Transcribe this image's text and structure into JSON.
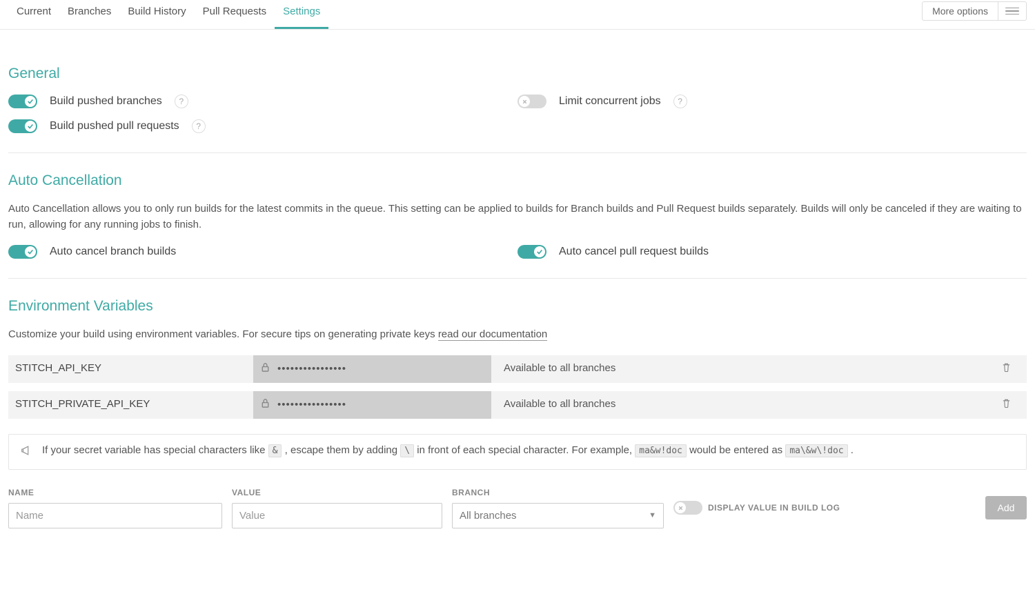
{
  "tabs": [
    "Current",
    "Branches",
    "Build History",
    "Pull Requests",
    "Settings"
  ],
  "active_tab": "Settings",
  "more_options_label": "More options",
  "sections": {
    "general": {
      "title": "General",
      "items": {
        "build_pushed_branches": {
          "label": "Build pushed branches",
          "on": true,
          "help": true
        },
        "build_pushed_prs": {
          "label": "Build pushed pull requests",
          "on": true,
          "help": true
        },
        "limit_concurrent": {
          "label": "Limit concurrent jobs",
          "on": false,
          "help": true
        }
      }
    },
    "auto_cancel": {
      "title": "Auto Cancellation",
      "desc": "Auto Cancellation allows you to only run builds for the latest commits in the queue. This setting can be applied to builds for Branch builds and Pull Request builds separately. Builds will only be canceled if they are waiting to run, allowing for any running jobs to finish.",
      "items": {
        "cancel_branch": {
          "label": "Auto cancel branch builds",
          "on": true
        },
        "cancel_pr": {
          "label": "Auto cancel pull request builds",
          "on": true
        }
      }
    },
    "env_vars": {
      "title": "Environment Variables",
      "desc_prefix": "Customize your build using environment variables. For secure tips on generating private keys ",
      "doc_link_text": "read our documentation",
      "rows": [
        {
          "name": "STITCH_API_KEY",
          "masked": "••••••••••••••••",
          "scope": "Available to all branches"
        },
        {
          "name": "STITCH_PRIVATE_API_KEY",
          "masked": "••••••••••••••••",
          "scope": "Available to all branches"
        }
      ],
      "info": {
        "t1": "If your secret variable has special characters like ",
        "c1": "&",
        "t2": ", escape them by adding ",
        "c2": "\\",
        "t3": " in front of each special character. For example, ",
        "c3": "ma&w!doc",
        "t4": " would be entered as ",
        "c4": "ma\\&w\\!doc",
        "t5": " ."
      },
      "form": {
        "name_label": "NAME",
        "name_placeholder": "Name",
        "value_label": "VALUE",
        "value_placeholder": "Value",
        "branch_label": "BRANCH",
        "branch_selected": "All branches",
        "display_log_label": "DISPLAY VALUE IN BUILD LOG",
        "display_log_on": false,
        "add_label": "Add"
      }
    }
  }
}
